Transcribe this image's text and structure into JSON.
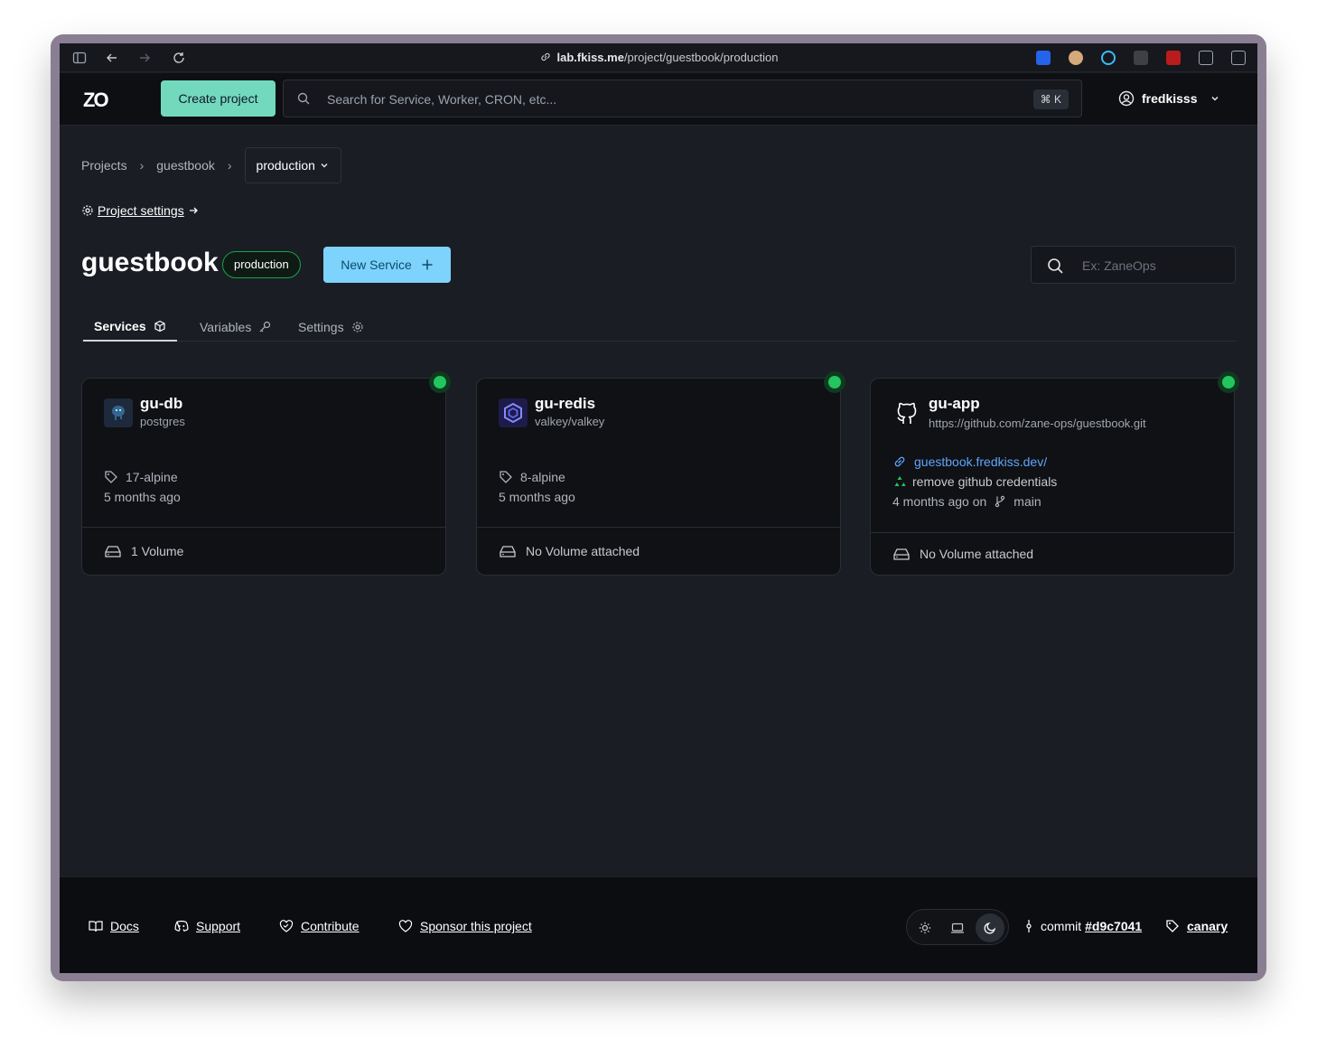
{
  "browser": {
    "url_host": "lab.fkiss.me",
    "url_path": "/project/guestbook/production"
  },
  "header": {
    "logo_text": "ZO",
    "create_project_label": "Create project",
    "search_placeholder": "Search for Service, Worker, CRON, etc...",
    "shortcut": "⌘ K",
    "username": "fredkisss"
  },
  "breadcrumb": {
    "items": [
      "Projects",
      "guestbook"
    ],
    "current": "production"
  },
  "project_settings_label": "Project settings",
  "project": {
    "name": "guestbook",
    "environment": "production",
    "new_service_label": "New Service",
    "filter_placeholder": "Ex: ZaneOps"
  },
  "tabs": [
    {
      "label": "Services",
      "icon": "box-icon"
    },
    {
      "label": "Variables",
      "icon": "key-icon"
    },
    {
      "label": "Settings",
      "icon": "gear-icon"
    }
  ],
  "services": [
    {
      "name": "gu-db",
      "image": "postgres",
      "tag": "17-alpine",
      "updated": "5 months ago",
      "volume": "1 Volume",
      "status_color": "#22c55e",
      "icon": "postgres-icon"
    },
    {
      "name": "gu-redis",
      "image": "valkey/valkey",
      "tag": "8-alpine",
      "updated": "5 months ago",
      "volume": "No Volume attached",
      "status_color": "#22c55e",
      "icon": "valkey-icon"
    },
    {
      "name": "gu-app",
      "repo": "https://github.com/zane-ops/guestbook.git",
      "url": "guestbook.fredkiss.dev/",
      "commit_message": "remove github credentials",
      "updated": "4 months ago on",
      "branch": "main",
      "volume": "No Volume attached",
      "status_color": "#22c55e",
      "icon": "github-icon"
    }
  ],
  "footer": {
    "links": [
      "Docs",
      "Support",
      "Contribute",
      "Sponsor this project"
    ],
    "commit_label": "commit",
    "commit_hash": "#d9c7041",
    "channel": "canary"
  },
  "colors": {
    "accent_green": "#73d9bd",
    "accent_blue": "#7dd3fc",
    "status_green": "#22c55e",
    "link_blue": "#60a5fa"
  }
}
